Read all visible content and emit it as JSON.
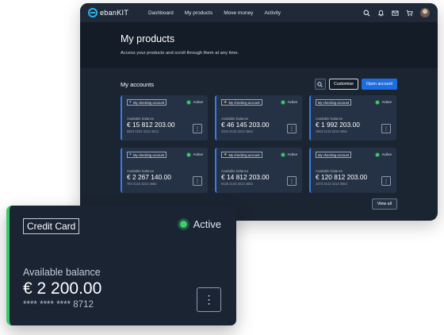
{
  "colors": {
    "accent": "#1d6de0",
    "active": "#3ccf6a",
    "card_bg": "#253245",
    "card_border": "#3b7ae8"
  },
  "app": {
    "logo_text": "ebanKIT"
  },
  "nav": {
    "links": [
      "Dashboard",
      "My products",
      "Move money",
      "Activity"
    ],
    "icons": [
      "search-icon",
      "bell-icon",
      "mail-icon",
      "cart-icon",
      "avatar"
    ]
  },
  "hero": {
    "title": "My products",
    "subtitle": "Access your products and scroll through them at any time."
  },
  "accounts": {
    "title": "My accounts",
    "customise_label": "Customise",
    "open_label": "Open account",
    "view_all_label": "View all",
    "cards": [
      {
        "tag": "My checking account",
        "tag_icon": "heart-icon",
        "status": "Active",
        "label": "Available balance",
        "amount": "€ 15 812 203.00",
        "number": "5823 2234 3213 4512"
      },
      {
        "tag": "My checking account",
        "tag_icon": "star-icon",
        "status": "Active",
        "label": "Available balance",
        "amount": "€ 46 145 203.00",
        "number": "2343 2143 3213 4562"
      },
      {
        "tag": "My checking account",
        "tag_icon": "",
        "status": "Active",
        "label": "Available balance",
        "amount": "€ 1 992 203.00",
        "number": "1563 2143 3213 4562"
      },
      {
        "tag": "My checking account",
        "tag_icon": "heart-icon",
        "status": "Active",
        "label": "Available balance",
        "amount": "€ 2 267 140.00",
        "number": "784 2143 3213 4562"
      },
      {
        "tag": "My checking account",
        "tag_icon": "star-icon",
        "status": "Active",
        "label": "Available balance",
        "amount": "€ 14 812 203.00",
        "number": "9135 2143 3213 4562"
      },
      {
        "tag": "My checking account",
        "tag_icon": "",
        "status": "Active",
        "label": "Available balance",
        "amount": "€ 120 812 203.00",
        "number": "1373 2143 3213 4562"
      }
    ]
  },
  "credit_card": {
    "tag": "Credit Card",
    "status": "Active",
    "label": "Available balance",
    "amount": "€ 2 200.00",
    "number": "**** **** **** 8712"
  }
}
